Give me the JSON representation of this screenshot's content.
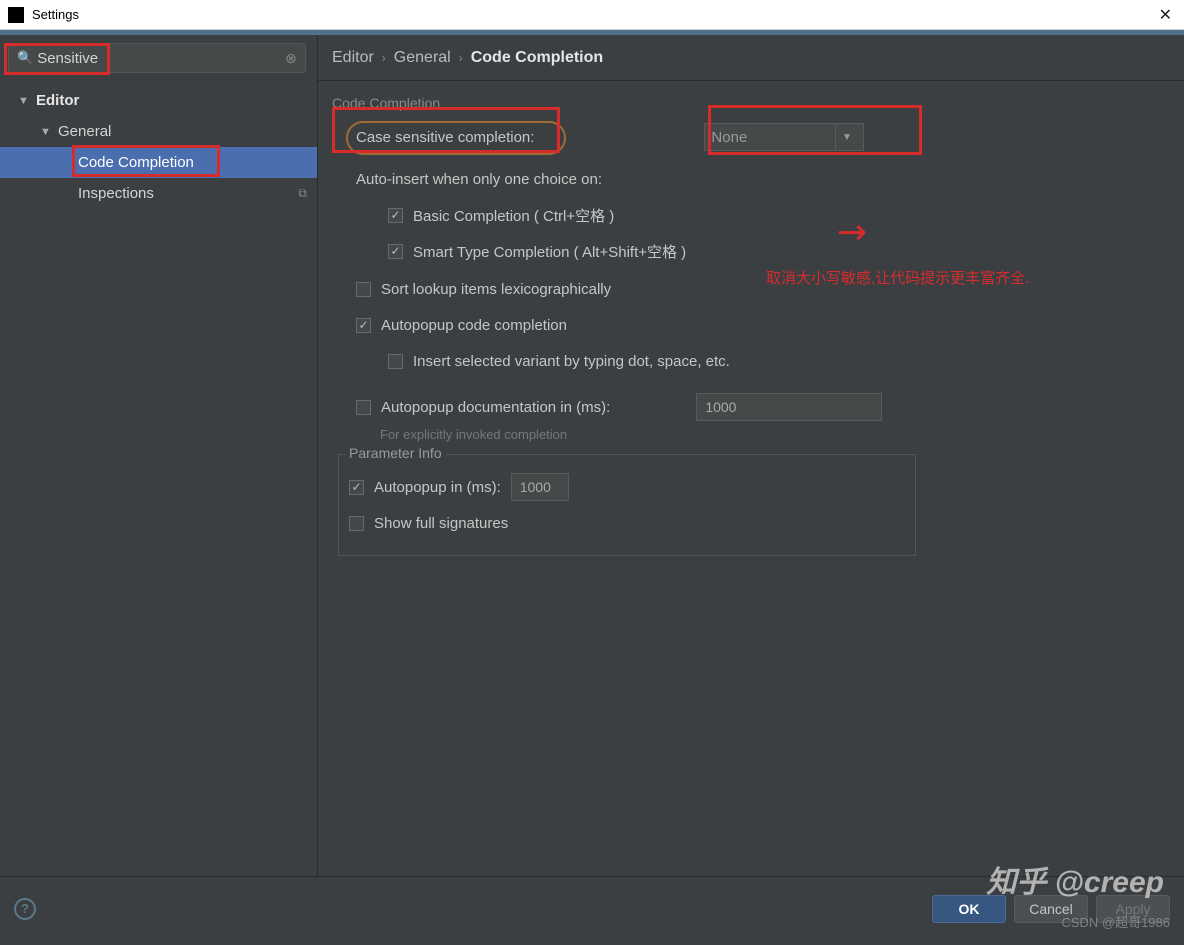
{
  "window": {
    "title": "Settings"
  },
  "search": {
    "value": "Sensitive"
  },
  "tree": {
    "editor": "Editor",
    "general": "General",
    "code_completion": "Code Completion",
    "inspections": "Inspections"
  },
  "breadcrumb": {
    "editor": "Editor",
    "general": "General",
    "cc": "Code Completion"
  },
  "section": {
    "title": "Code Completion",
    "case_label": "Case sensitive completion:",
    "case_value": "None",
    "auto_insert": "Auto-insert when only one choice on:",
    "basic": "Basic Completion ( Ctrl+空格 )",
    "smart": "Smart Type Completion ( Alt+Shift+空格 )",
    "sort": "Sort lookup items lexicographically",
    "autopopup_cc": "Autopopup code completion",
    "insert_variant": "Insert selected variant by typing dot, space, etc.",
    "autopopup_doc": "Autopopup documentation in (ms):",
    "autopopup_doc_val": "1000",
    "autopopup_doc_sub": "For explicitly invoked completion",
    "pi_title": "Parameter Info",
    "pi_autopopup": "Autopopup in (ms):",
    "pi_autopopup_val": "1000",
    "pi_full_sig": "Show full signatures"
  },
  "annotation": "取消大小写敏感,让代码提示更丰富齐全.",
  "buttons": {
    "ok": "OK",
    "cancel": "Cancel",
    "apply": "Apply"
  },
  "watermark1": "知乎 @creep",
  "watermark2": "CSDN @超哥1986"
}
